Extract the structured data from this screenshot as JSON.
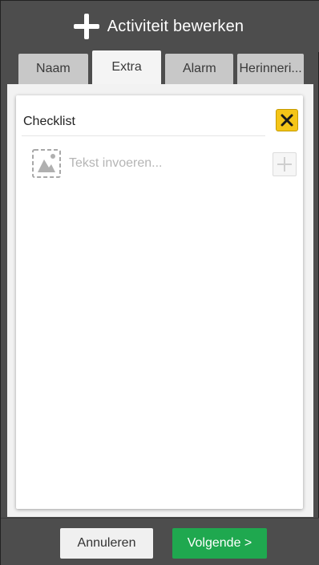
{
  "header": {
    "title": "Activiteit bewerken",
    "icon": "plus-icon"
  },
  "tabs": [
    {
      "label": "Naam",
      "active": false
    },
    {
      "label": "Extra",
      "active": true
    },
    {
      "label": "Alarm",
      "active": false
    },
    {
      "label": "Herinneri...",
      "active": false
    }
  ],
  "checklist": {
    "label": "Checklist",
    "input_placeholder": "Tekst invoeren...",
    "input_value": ""
  },
  "footer": {
    "cancel_label": "Annuleren",
    "next_label": "Volgende >"
  },
  "colors": {
    "header_bg": "#4d4d4d",
    "close_button_bg": "#f5c518",
    "next_button_bg": "#1fa84f",
    "tab_active_bg": "#f4f4f4",
    "tab_inactive_bg": "#c8c8c8"
  }
}
